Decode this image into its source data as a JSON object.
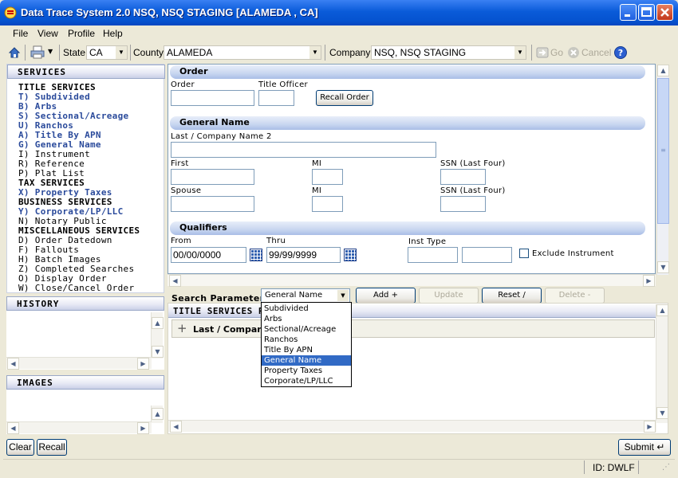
{
  "window": {
    "title": "Data Trace System 2.0 NSQ, NSQ STAGING [ALAMEDA , CA]"
  },
  "menu": [
    "File",
    "View",
    "Profile",
    "Help"
  ],
  "toolbar": {
    "state_label": "State",
    "state_value": "CA",
    "county_label": "County",
    "county_value": "ALAMEDA",
    "company_label": "Company",
    "company_value": "NSQ, NSQ STAGING",
    "go_label": "Go",
    "cancel_label": "Cancel"
  },
  "services": {
    "header": "SERVICES",
    "items": [
      {
        "text": "TITLE SERVICES",
        "kind": "hdr"
      },
      {
        "text": "T) Subdivided",
        "kind": "link"
      },
      {
        "text": "B) Arbs",
        "kind": "link"
      },
      {
        "text": "S) Sectional/Acreage",
        "kind": "link"
      },
      {
        "text": "U) Ranchos",
        "kind": "link"
      },
      {
        "text": "A) Title By APN",
        "kind": "link"
      },
      {
        "text": "G) General Name",
        "kind": "link"
      },
      {
        "text": "I) Instrument",
        "kind": "plain"
      },
      {
        "text": "R) Reference",
        "kind": "plain"
      },
      {
        "text": "P) Plat List",
        "kind": "plain"
      },
      {
        "text": "TAX SERVICES",
        "kind": "hdr"
      },
      {
        "text": "X) Property Taxes",
        "kind": "link"
      },
      {
        "text": "BUSINESS SERVICES",
        "kind": "hdr"
      },
      {
        "text": "Y) Corporate/LP/LLC",
        "kind": "link"
      },
      {
        "text": "N) Notary Public",
        "kind": "plain"
      },
      {
        "text": "MISCELLANEOUS SERVICES",
        "kind": "hdr"
      },
      {
        "text": "D) Order Datedown",
        "kind": "plain"
      },
      {
        "text": "F) Fallouts",
        "kind": "plain"
      },
      {
        "text": "H) Batch Images",
        "kind": "plain"
      },
      {
        "text": "Z) Completed Searches",
        "kind": "plain"
      },
      {
        "text": "O) Display Order",
        "kind": "plain"
      },
      {
        "text": "W) Close/Cancel Order",
        "kind": "plain"
      }
    ]
  },
  "history": {
    "header": "HISTORY"
  },
  "images": {
    "header": "IMAGES"
  },
  "order": {
    "header": "Order",
    "order_label": "Order",
    "order_value": "",
    "title_officer_label": "Title Officer",
    "title_officer_value": "",
    "recall_order_label": "Recall Order"
  },
  "general_name": {
    "header": "General Name",
    "last_company_label": "Last / Company Name 2",
    "first_label": "First",
    "mi_label": "MI",
    "ssn_label": "SSN (Last Four)",
    "spouse_label": "Spouse",
    "mi2_label": "MI",
    "ssn2_label": "SSN (Last Four)"
  },
  "qualifiers": {
    "header": "Qualifiers",
    "from_label": "From",
    "from_value": "00/00/0000",
    "thru_label": "Thru",
    "thru_value": "99/99/9999",
    "inst_type_label": "Inst Type",
    "exclude_label": "Exclude Instrument",
    "exclude_checked": false
  },
  "search": {
    "label": "Search Parameters",
    "selected": "General Name",
    "options": [
      "Subdivided",
      "Arbs",
      "Sectional/Acreage",
      "Ranchos",
      "Title By APN",
      "General Name",
      "Property Taxes",
      "Corporate/LP/LLC"
    ],
    "add_label": "Add +",
    "update_label": "Update",
    "reset_label": "Reset /",
    "delete_label": "Delete -"
  },
  "params_panel": {
    "header": "TITLE SERVICES PA",
    "row_label": "Last / Company"
  },
  "footer": {
    "clear_label": "Clear",
    "recall_label": "Recall",
    "submit_label": "Submit",
    "status_id": "ID: DWLF"
  }
}
